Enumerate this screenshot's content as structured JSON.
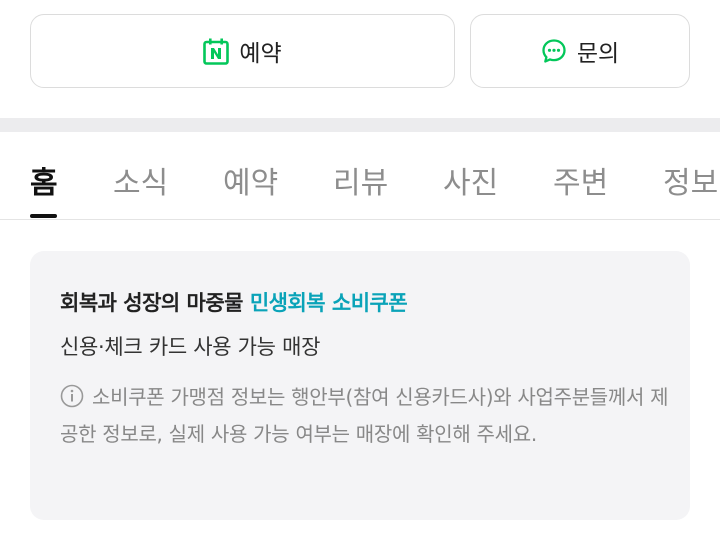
{
  "actions": {
    "reserve_label": "예약",
    "inquiry_label": "문의"
  },
  "tabs": [
    {
      "label": "홈",
      "active": true
    },
    {
      "label": "소식"
    },
    {
      "label": "예약"
    },
    {
      "label": "리뷰"
    },
    {
      "label": "사진"
    },
    {
      "label": "주변"
    },
    {
      "label": "정보"
    }
  ],
  "coupon": {
    "title_prefix": "회복과 성장의 마중물",
    "title_highlight": "민생회복 소비쿠폰",
    "subtitle": "신용·체크 카드 사용 가능 매장",
    "note": "소비쿠폰 가맹점 정보는 행안부(참여 신용카드사)와 사업주분들께서 제공한 정보로, 실제 사용 가능 여부는 매장에 확인해 주세요."
  },
  "colors": {
    "naver_green": "#03c75a",
    "highlight_teal": "#0aa3b8",
    "band_gray": "#ececee",
    "card_bg": "#f4f4f6"
  },
  "icons": {
    "reserve": "naver-booking-icon",
    "inquiry": "chat-bubble-icon",
    "note": "info-icon"
  }
}
